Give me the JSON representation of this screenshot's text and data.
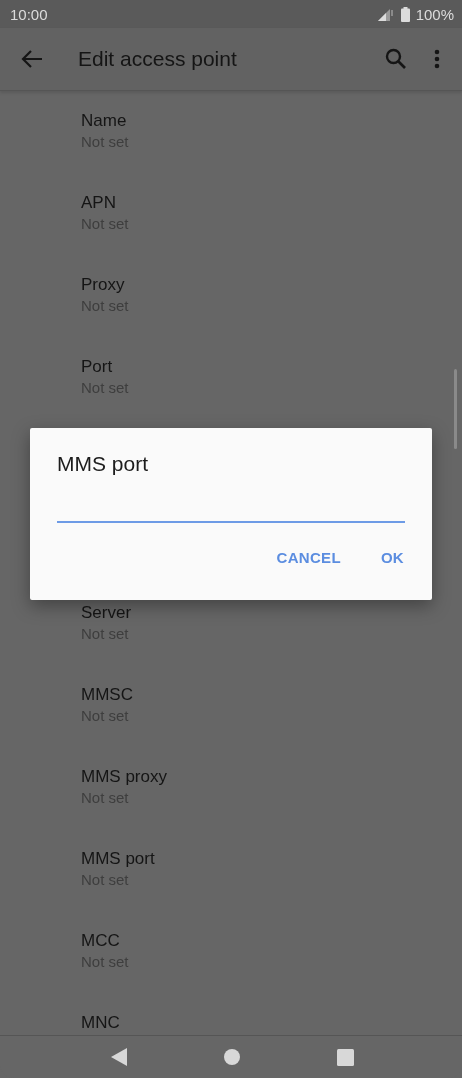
{
  "status_bar": {
    "time": "10:00",
    "battery": "100%"
  },
  "app_bar": {
    "title": "Edit access point"
  },
  "settings": [
    {
      "title": "Name",
      "value": "Not set"
    },
    {
      "title": "APN",
      "value": "Not set"
    },
    {
      "title": "Proxy",
      "value": "Not set"
    },
    {
      "title": "Port",
      "value": "Not set"
    },
    {
      "title": "Server",
      "value": "Not set"
    },
    {
      "title": "MMSC",
      "value": "Not set"
    },
    {
      "title": "MMS proxy",
      "value": "Not set"
    },
    {
      "title": "MMS port",
      "value": "Not set"
    },
    {
      "title": "MCC",
      "value": "Not set"
    },
    {
      "title": "MNC"
    }
  ],
  "dialog": {
    "title": "MMS port",
    "buttons": [
      "CANCEL",
      "OK"
    ]
  }
}
